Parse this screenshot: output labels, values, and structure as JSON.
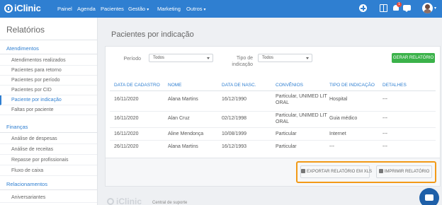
{
  "topbar": {
    "brand": "iClinic",
    "nav": [
      "Painel",
      "Agenda",
      "Pacientes",
      "Gestão",
      "Marketing",
      "Outros"
    ],
    "notification_count": "1",
    "colors": {
      "bar": "#2f7fd1",
      "badge": "#e74c3c"
    }
  },
  "sidebar": {
    "title": "Relatórios",
    "sections": [
      {
        "label": "Atendimentos",
        "items": [
          "Atendimentos realizados",
          "Pacientes para retorno",
          "Pacientes por período",
          "Pacientes por CID",
          "Paciente por indicação",
          "Faltas por paciente"
        ]
      },
      {
        "label": "Finanças",
        "items": [
          "Análise de despesas",
          "Análise de receitas",
          "Repasse por profissionais",
          "Fluxo de caixa"
        ]
      },
      {
        "label": "Relacionamentos",
        "items": [
          "Aniversariantes"
        ]
      }
    ],
    "active_item": "Paciente por indicação"
  },
  "main": {
    "title": "Pacientes por indicação",
    "filters": {
      "period_label": "Período",
      "period_value": "Todos",
      "type_label_1": "Tipo de",
      "type_label_2": "indicação",
      "type_value": "Todos"
    },
    "generate_button": "GERAR RELATÓRIO",
    "table": {
      "headers": [
        "DATA DE CADASTRO",
        "NOME",
        "DATA DE NASC.",
        "CONVÊNIOS",
        "TIPO DE INDICAÇÃO",
        "DETALHES"
      ],
      "rows": [
        [
          "16/11/2020",
          "Alana Martins",
          "16/12/1990",
          "Particular, UNIMED LIT",
          "ORAL",
          "Hospital",
          "---"
        ],
        [
          "16/11/2020",
          "Alan Cruz",
          "02/12/1998",
          "Particular, UNIMED LIT",
          "ORAL",
          "Guia médico",
          "---"
        ],
        [
          "16/11/2020",
          "Aline Mendonça",
          "10/08/1999",
          "Particular",
          "",
          "Internet",
          "---"
        ],
        [
          "26/11/2020",
          "Alana Martins",
          "16/12/1993",
          "Particular",
          "",
          "---",
          "---"
        ]
      ]
    },
    "export_button": "EXPORTAR RELATÓRIO EM XLS",
    "print_button": "IMPRIMIR RELATÓRIO",
    "highlight_color": "#f29a17"
  },
  "footer": {
    "brand": "iClinic",
    "support": "Central de suporte"
  }
}
